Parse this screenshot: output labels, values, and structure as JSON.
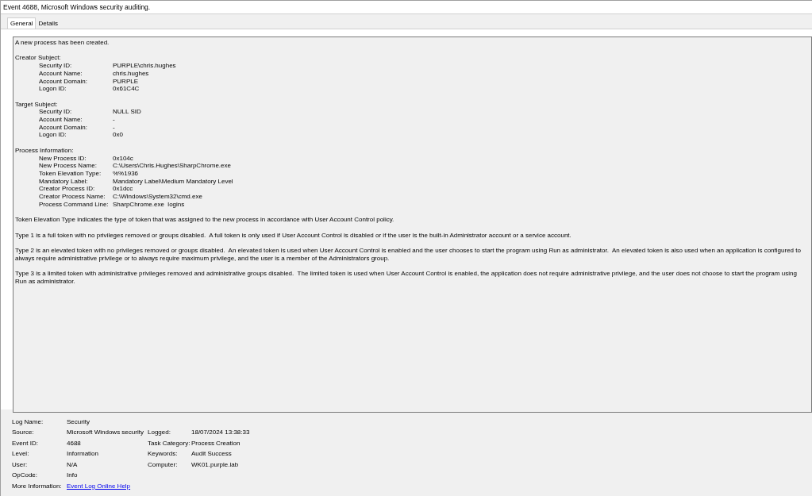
{
  "window": {
    "title": "Event 4688, Microsoft Windows security auditing."
  },
  "tabs": [
    {
      "label": "General",
      "selected": true
    },
    {
      "label": "Details",
      "selected": false
    }
  ],
  "description": {
    "intro": "A new process has been created.",
    "sections": [
      {
        "heading": "Creator Subject:",
        "fields": [
          {
            "label": "Security ID:",
            "value": "PURPLE\\chris.hughes"
          },
          {
            "label": "Account Name:",
            "value": "chris.hughes"
          },
          {
            "label": "Account Domain:",
            "value": "PURPLE"
          },
          {
            "label": "Logon ID:",
            "value": "0x61C4C"
          }
        ]
      },
      {
        "heading": "Target Subject:",
        "fields": [
          {
            "label": "Security ID:",
            "value": "NULL SID"
          },
          {
            "label": "Account Name:",
            "value": "-"
          },
          {
            "label": "Account Domain:",
            "value": "-"
          },
          {
            "label": "Logon ID:",
            "value": "0x0"
          }
        ]
      },
      {
        "heading": "Process Information:",
        "fields": [
          {
            "label": "New Process ID:",
            "value": "0x104c"
          },
          {
            "label": "New Process Name:",
            "value": "C:\\Users\\Chris.Hughes\\SharpChrome.exe"
          },
          {
            "label": "Token Elevation Type:",
            "value": "%%1936"
          },
          {
            "label": "Mandatory Label:",
            "value": "Mandatory Label\\Medium Mandatory Level"
          },
          {
            "label": "Creator Process ID:",
            "value": "0x1dcc"
          },
          {
            "label": "Creator Process Name:",
            "value": "C:\\Windows\\System32\\cmd.exe"
          },
          {
            "label": "Process Command Line:",
            "value": "SharpChrome.exe  logins"
          }
        ]
      }
    ],
    "paragraphs": [
      "Token Elevation Type indicates the type of token that was assigned to the new process in accordance with User Account Control policy.",
      "Type 1 is a full token with no privileges removed or groups disabled.  A full token is only used if User Account Control is disabled or if the user is the built-in Administrator account or a service account.",
      "Type 2 is an elevated token with no privileges removed or groups disabled.  An elevated token is used when User Account Control is enabled and the user chooses to start the program using Run as administrator.  An elevated token is also used when an application is configured to always require administrative privilege or to always require maximum privilege, and the user is a member of the Administrators group.",
      "Type 3 is a limited token with administrative privileges removed and administrative groups disabled.  The limited token is used when User Account Control is enabled, the application does not require administrative privilege, and the user does not choose to start the program using Run as administrator."
    ]
  },
  "properties": [
    {
      "label": "Log Name:",
      "value": "Security"
    },
    {
      "label": "Source:",
      "value": "Microsoft Windows security",
      "label_2": "Logged:",
      "value_2": "18/07/2024 13:38:33"
    },
    {
      "label": "Event ID:",
      "value": "4688",
      "label_2": "Task Category:",
      "value_2": "Process Creation"
    },
    {
      "label": "Level:",
      "value": "Information",
      "label_2": "Keywords:",
      "value_2": "Audit Success"
    },
    {
      "label": "User:",
      "value": "N/A",
      "label_2": "Computer:",
      "value_2": "WK01.purple.lab"
    },
    {
      "label": "OpCode:",
      "value": "Info"
    },
    {
      "label": "More Information:",
      "link": "Event Log Online Help"
    }
  ]
}
